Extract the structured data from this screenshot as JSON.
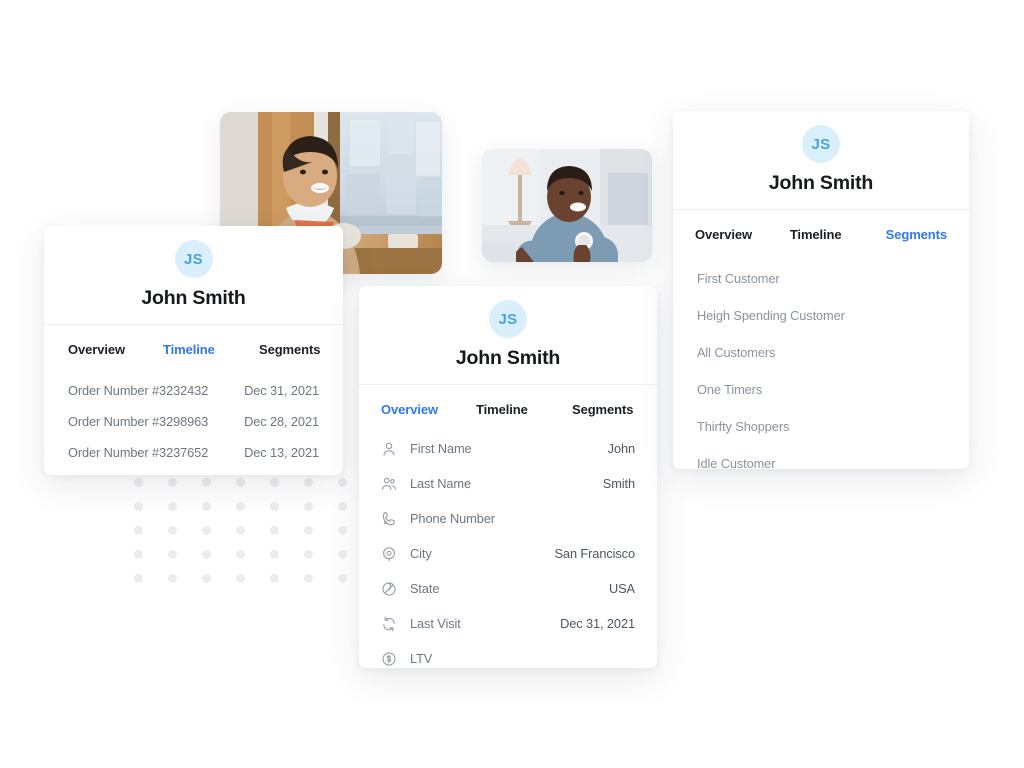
{
  "background": "#ffffff",
  "colors": {
    "accent": "#2f78f0",
    "avatar_bg": "#d9effb",
    "avatar_text": "#4ba3dd",
    "muted_text": "#6d7782",
    "title_text": "#15181d",
    "placeholder_bar": "#e2e4e8",
    "dot_grid": "#ececee"
  },
  "dot_grid": {
    "columns": 7,
    "rows": 5,
    "spacing": 34,
    "dot_size": 9
  },
  "photos": [
    {
      "name": "photo-man-smiling-cafe",
      "alt": "Smiling man in tan jacket sitting by a cafe window"
    },
    {
      "name": "photo-man-smiling-couch",
      "alt": "Smiling man in blue t-shirt holding a cup on a couch"
    }
  ],
  "cards": {
    "timeline_card": {
      "avatar_initials": "JS",
      "name": "John Smith",
      "tabs": [
        {
          "label": "Overview",
          "active": false
        },
        {
          "label": "Timeline",
          "active": true
        },
        {
          "label": "Segments",
          "active": false
        }
      ],
      "rows": [
        {
          "order": "Order Number #3232432",
          "date": "Dec 31, 2021"
        },
        {
          "order": "Order Number #3298963",
          "date": "Dec 28, 2021"
        },
        {
          "order": "Order Number #3237652",
          "date": "Dec 13, 2021"
        }
      ]
    },
    "overview_card": {
      "avatar_initials": "JS",
      "name": "John Smith",
      "tabs": [
        {
          "label": "Overview",
          "active": true
        },
        {
          "label": "Timeline",
          "active": false
        },
        {
          "label": "Segments",
          "active": false
        }
      ],
      "fields": [
        {
          "icon": "user-icon",
          "label": "First Name",
          "value": "John",
          "type": "text"
        },
        {
          "icon": "users-icon",
          "label": "Last Name",
          "value": "Smith",
          "type": "text"
        },
        {
          "icon": "phone-icon",
          "label": "Phone Number",
          "value": "",
          "type": "bar-long"
        },
        {
          "icon": "location-pin-icon",
          "label": "City",
          "value": "San Francisco",
          "type": "text"
        },
        {
          "icon": "globe-slash-icon",
          "label": "State",
          "value": "USA",
          "type": "text"
        },
        {
          "icon": "refresh-icon",
          "label": "Last Visit",
          "value": "Dec 31, 2021",
          "type": "text"
        },
        {
          "icon": "dollar-circle-icon",
          "label": "LTV",
          "value": "",
          "type": "bar-short"
        }
      ]
    },
    "segments_card": {
      "avatar_initials": "JS",
      "name": "John Smith",
      "tabs": [
        {
          "label": "Overview",
          "active": false
        },
        {
          "label": "Timeline",
          "active": false
        },
        {
          "label": "Segments",
          "active": true
        }
      ],
      "segments": [
        "First Customer",
        "Heigh Spending Customer",
        "All Customers",
        "One Timers",
        "Thirfty Shoppers",
        "Idle Customer"
      ]
    }
  }
}
